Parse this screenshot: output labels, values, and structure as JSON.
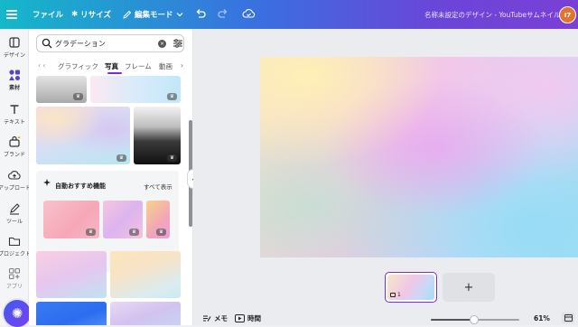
{
  "topbar": {
    "file": "ファイル",
    "resize": "リサイズ",
    "edit_mode": "編集モード",
    "title": "名称未設定のデザイン - YouTubeサムネイル",
    "avatar_initials": "I7"
  },
  "rail": [
    {
      "label": "デザイン",
      "icon": "layout-icon"
    },
    {
      "label": "素材",
      "icon": "elements-icon"
    },
    {
      "label": "テキスト",
      "icon": "text-icon"
    },
    {
      "label": "ブランド",
      "icon": "brand-icon"
    },
    {
      "label": "アップロード",
      "icon": "upload-icon"
    },
    {
      "label": "ツール",
      "icon": "draw-icon"
    },
    {
      "label": "プロジェクト",
      "icon": "folder-icon"
    },
    {
      "label": "アプリ",
      "icon": "apps-icon"
    }
  ],
  "panel": {
    "search_value": "グラデーション",
    "tabs": [
      "グラフィック",
      "写真",
      "フレーム",
      "動画"
    ],
    "active_tab": "写真",
    "auto_title": "自動おすすめ機能",
    "see_all": "すべて表示"
  },
  "canvas": {
    "page_number": "1"
  },
  "bottombar": {
    "notes": "メモ",
    "timer": "時間",
    "zoom": "61%",
    "zoom_fraction": 0.61
  },
  "colors": {
    "accent": "#7d2ae8",
    "topbar_start": "#14b8c9",
    "topbar_end": "#7b3fd6"
  }
}
